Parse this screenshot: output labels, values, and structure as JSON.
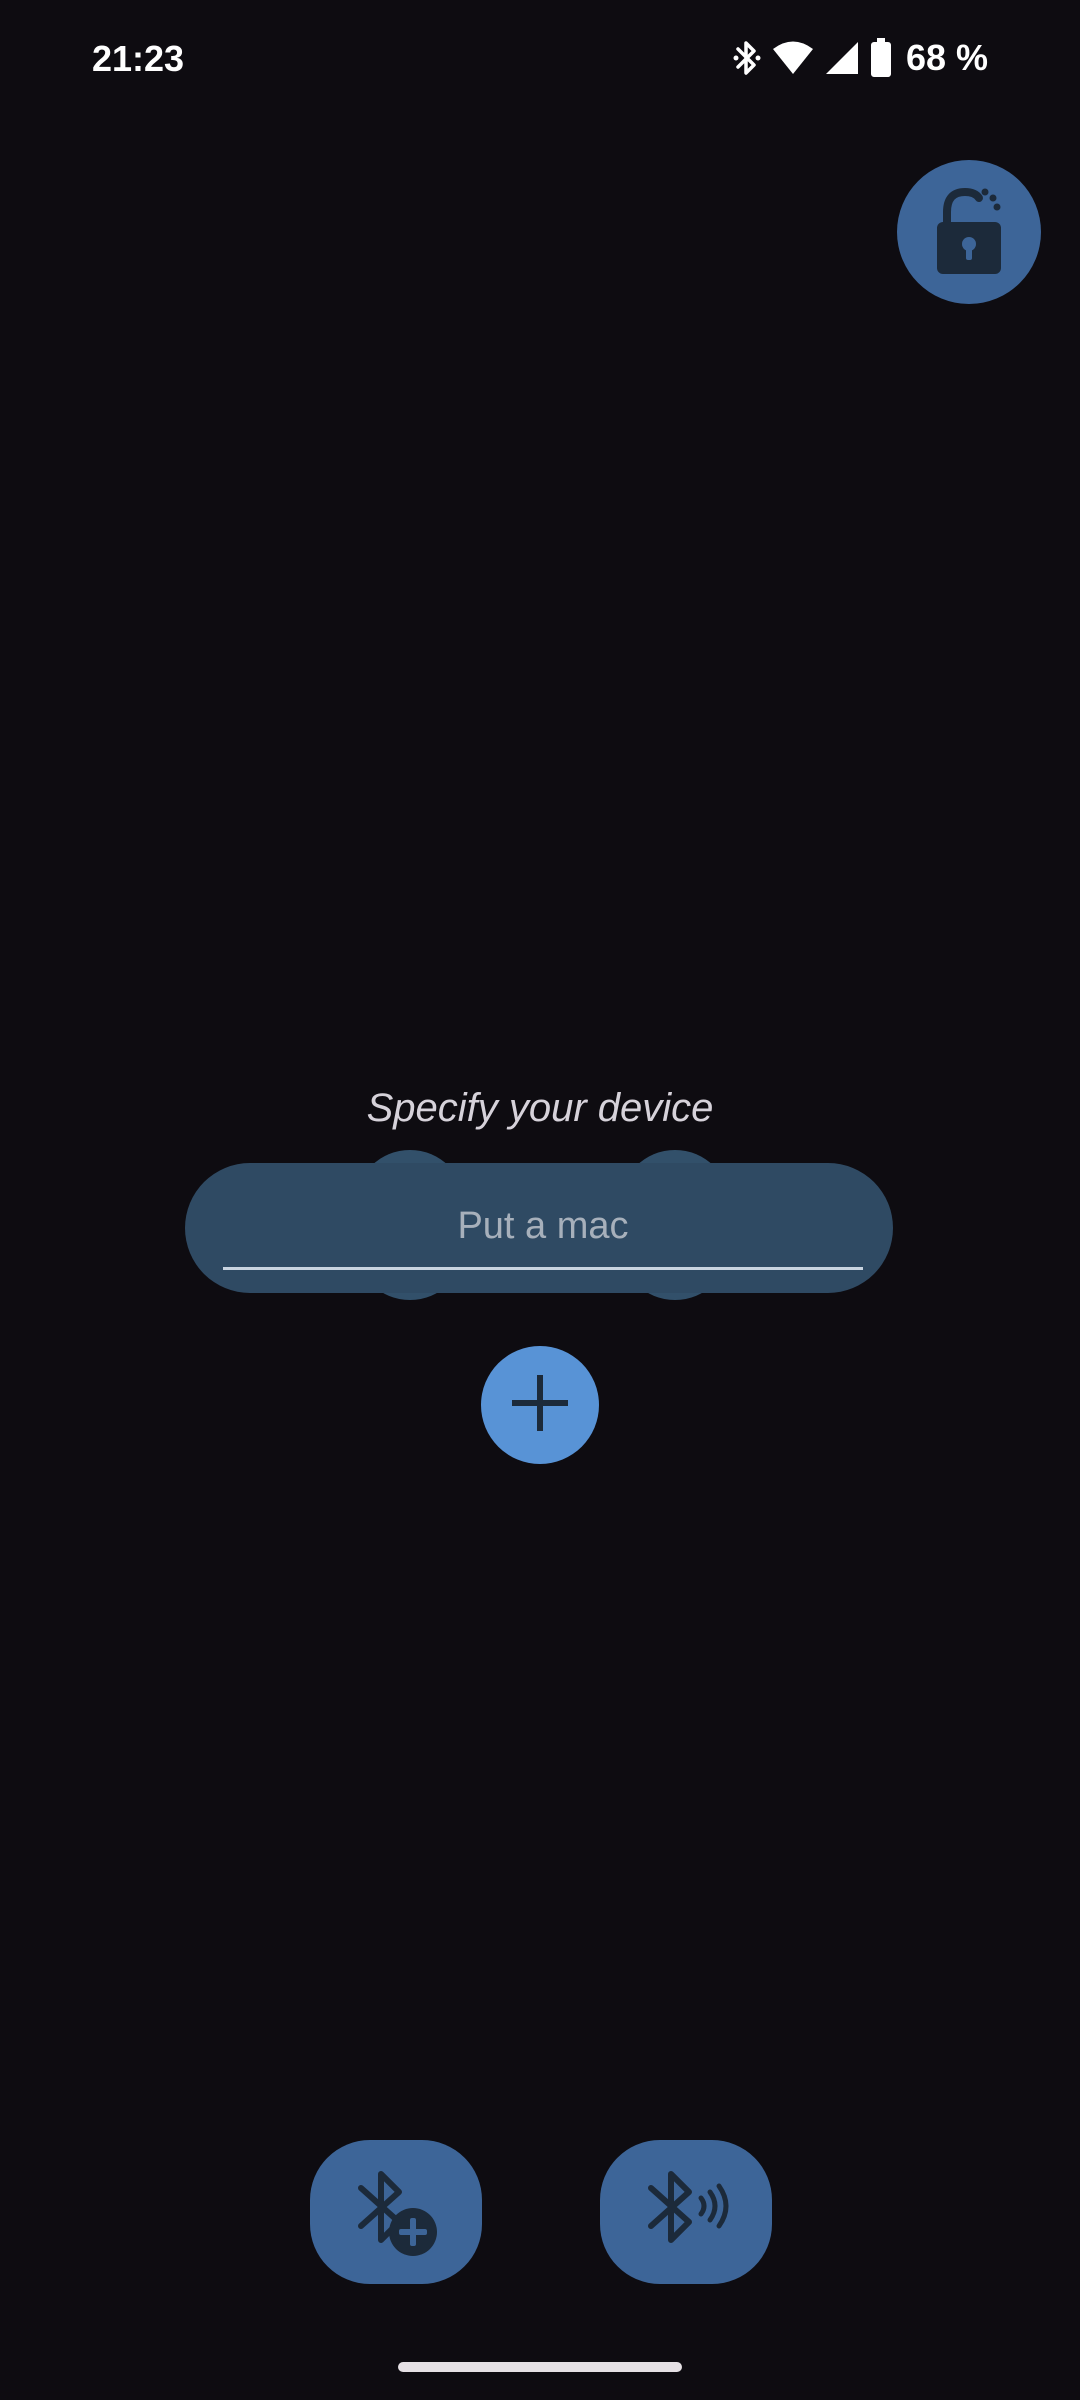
{
  "status_bar": {
    "time": "21:23",
    "battery": "68 %",
    "icons": [
      "bluetooth-icon",
      "wifi-icon",
      "signal-icon",
      "battery-icon"
    ]
  },
  "lock_button": {
    "icon": "lock-open-icon"
  },
  "device_form": {
    "label": "Specify your device",
    "mac_input": {
      "value": "",
      "placeholder": "Put a mac"
    },
    "add_button_icon": "plus-icon"
  },
  "bottom_actions": {
    "pair_icon": "bluetooth-add-icon",
    "scan_icon": "bluetooth-searching-icon"
  },
  "colors": {
    "background": "#0e0c11",
    "accent": "#3d6598",
    "add_button": "#5893d6",
    "pill": "#2f4a63",
    "icon_dark": "#1c2a3a"
  }
}
